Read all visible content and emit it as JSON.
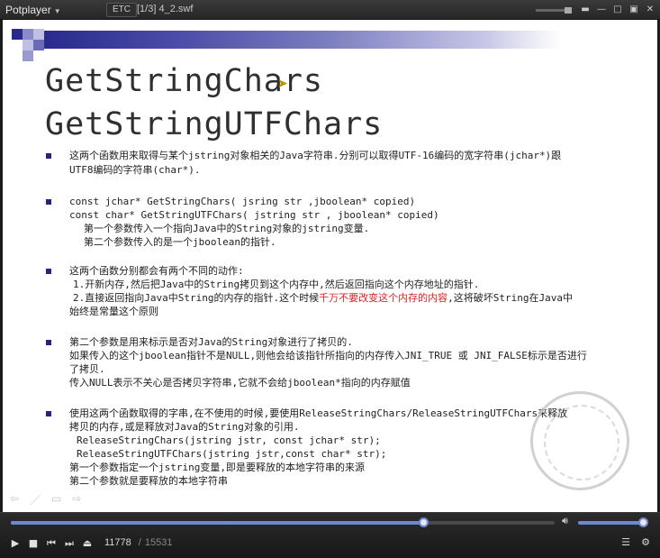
{
  "titlebar": {
    "app_name": "Potplayer",
    "category_badge": "ETC",
    "file_label": "[1/3] 4_2.swf"
  },
  "slide": {
    "title_line1": "GetStringChars",
    "title_line2": "GetStringUTFChars",
    "blocks": [
      {
        "lines": [
          {
            "text": "这两个函数用来取得与某个jstring对象相关的Java字符串.分别可以取得UTF-16编码的宽字符串(jchar*)跟"
          },
          {
            "text": "UTF8编码的字符串(char*)."
          }
        ]
      },
      {
        "lines": [
          {
            "text": "const jchar* GetStringChars( jsring str ,jboolean* copied)"
          },
          {
            "text": "const char* GetStringUTFChars( jstring str , jboolean* copied)"
          },
          {
            "text": "  第一个参数传入一个指向Java中的String对象的jstring变量."
          },
          {
            "text": "  第二个参数传入的是一个jboolean的指针."
          }
        ]
      },
      {
        "lines": [
          {
            "text": "这两个函数分别都会有两个不同的动作:"
          },
          {
            "text": " 1.开新内存,然后把Java中的String拷贝到这个内存中,然后返回指向这个内存地址的指针."
          },
          {
            "text": " 2.直接返回指向Java中String的内存的指针.这个时候",
            "red": "千万不要改变这个内存的内容",
            "after": ",这将破坏String在Java中"
          },
          {
            "text": "始终是常量这个原则"
          }
        ]
      },
      {
        "lines": [
          {
            "text": "第二个参数是用来标示是否对Java的String对象进行了拷贝的."
          },
          {
            "text": "如果传入的这个jboolean指针不是NULL,则他会给该指针所指向的内存传入JNI_TRUE 或 JNI_FALSE标示是否进行"
          },
          {
            "text": "了拷贝."
          },
          {
            "text": "传入NULL表示不关心是否拷贝字符串,它就不会给jboolean*指向的内存赋值"
          }
        ]
      },
      {
        "lines": [
          {
            "text": "使用这两个函数取得的字串,在不使用的时候,要使用ReleaseStringChars/ReleaseStringUTFChars来释放"
          },
          {
            "text": "拷贝的内存,或是释放对Java的String对象的引用."
          },
          {
            "text": "  ReleaseStringChars(jstring jstr, const jchar* str);"
          },
          {
            "text": "  ReleaseStringUTFChars(jstring jstr,const char* str);"
          },
          {
            "text": "第一个参数指定一个jstring变量,即是要释放的本地字符串的来源"
          },
          {
            "text": "第二个参数就是要释放的本地字符串"
          }
        ]
      }
    ]
  },
  "player": {
    "current_time": "11778",
    "total_time": "15531",
    "time_separator": "/",
    "seek_fraction": 0.7583,
    "volume_fraction": 0.92
  },
  "colors": {
    "accent": "#6f88d4",
    "bullet": "#252580",
    "warning_text": "#e02020"
  },
  "icons": {
    "titlebar": [
      "minimize-icon",
      "maximize-icon",
      "close-icon"
    ],
    "controls": [
      "play-icon",
      "stop-icon",
      "prev-icon",
      "next-icon",
      "eject-icon"
    ],
    "right": [
      "playlist-icon",
      "settings-icon"
    ]
  }
}
